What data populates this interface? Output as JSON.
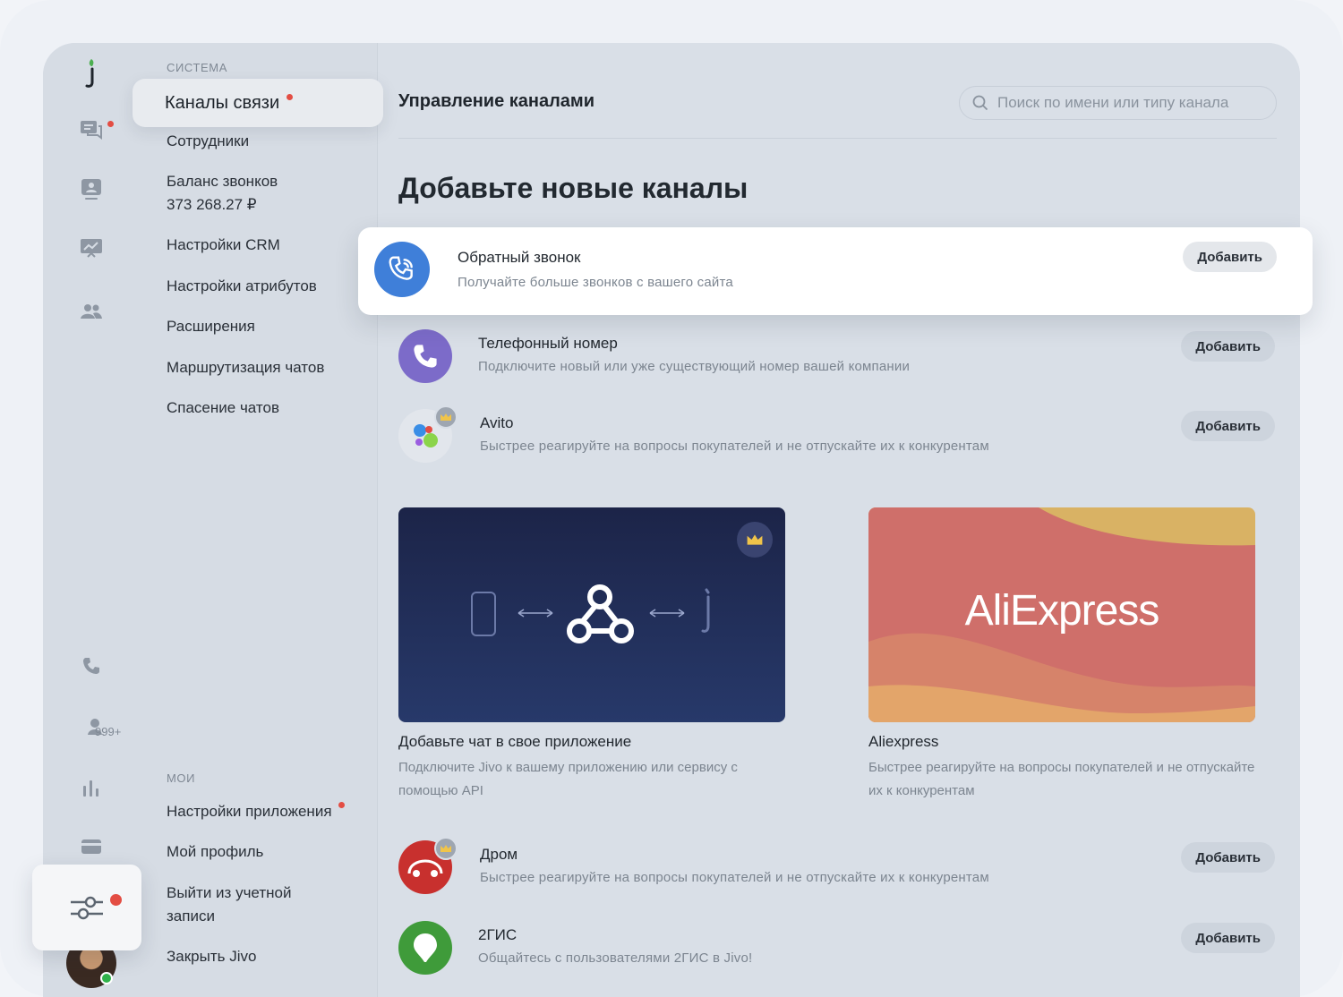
{
  "sidebar": {
    "system_label": "СИСТЕМА",
    "active_item": "Каналы связи",
    "items": [
      "Сотрудники",
      "Баланс звонков",
      "373 268.27 ₽",
      "Настройки CRM",
      "Настройки атрибутов",
      "Расширения",
      "Маршрутизация чатов",
      "Спасение чатов"
    ],
    "my_label": "МОИ",
    "my_items": [
      "Настройки приложения",
      "Мой профиль",
      "Выйти из учетной",
      "записи",
      "Закрыть Jivo"
    ]
  },
  "rail": {
    "badge_count": "999+",
    "icons": [
      "jivo-logo-icon",
      "chats-icon",
      "visitors-icon",
      "reports-icon",
      "team-icon",
      "phone-icon",
      "contacts-icon",
      "stats-icon",
      "billing-icon",
      "settings-sliders-icon"
    ]
  },
  "header": {
    "title": "Управление каналами",
    "search_placeholder": "Поиск по имени или типу канала"
  },
  "main": {
    "section_title": "Добавьте новые каналы",
    "add_label": "Добавить",
    "channels": [
      {
        "name": "Обратный звонок",
        "desc": "Получайте больше звонков с вашего сайта"
      },
      {
        "name": "Телефонный номер",
        "desc": "Подключите новый или уже существующий номер вашей компании"
      },
      {
        "name": "Avito",
        "desc": "Быстрее реагируйте на вопросы покупателей и не отпускайте их к конкурентам"
      },
      {
        "name": "Дром",
        "desc": "Быстрее реагируйте на вопросы покупателей и не отпускайте их к конкурентам"
      },
      {
        "name": "2ГИС",
        "desc": "Общайтесь с пользователями 2ГИС в Jivo!"
      }
    ],
    "promos": [
      {
        "name": "Добавьте чат в свое приложение",
        "desc": "Подключите Jivo к вашему приложению или сервису с помощью API"
      },
      {
        "name": "Aliexpress",
        "desc": "Быстрее реагируйте на вопросы покупателей и не отпускайте их к конкурентам",
        "logo_text": "AliExpress"
      }
    ]
  },
  "colors": {
    "accent_red": "#e34d43",
    "callback_blue": "#3f7fd9",
    "phone_purple": "#7c6bc9",
    "drom_red": "#c8302e",
    "gis_green": "#3f9b3a",
    "webhook_bg": "#1e2a52"
  }
}
